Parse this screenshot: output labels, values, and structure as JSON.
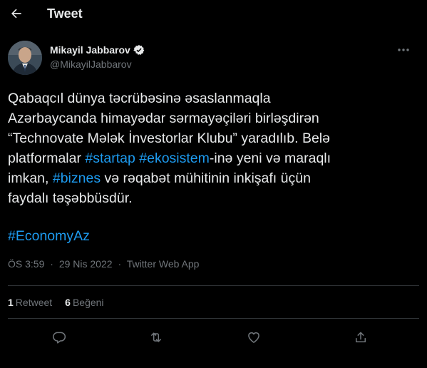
{
  "header": {
    "title": "Tweet",
    "back_icon": "arrow-left-icon"
  },
  "author": {
    "name": "Mikayil Jabbarov",
    "handle": "@MikayilJabbarov",
    "verified_icon": "verified-badge-icon",
    "more_icon": "more-horizontal-icon"
  },
  "tweet": {
    "lines": [
      [
        {
          "text": "Qabaqcıl dünya təcrübəsinə əsaslanmaqla"
        }
      ],
      [
        {
          "text": "Azərbaycanda himayədar sərmayəçiləri birləşdirən"
        }
      ],
      [
        {
          "text": "“Technovate Mələk İnvestorlar Klubu” yaradılıb. Belə"
        }
      ],
      [
        {
          "text": "platformalar "
        },
        {
          "text": "#startap",
          "tag": true
        },
        {
          "text": " "
        },
        {
          "text": "#ekosistem",
          "tag": true
        },
        {
          "text": "-inə yeni və maraqlı"
        }
      ],
      [
        {
          "text": "imkan, "
        },
        {
          "text": "#biznes",
          "tag": true
        },
        {
          "text": " və rəqabət mühitinin inkişafı üçün"
        }
      ],
      [
        {
          "text": "faydalı təşəbbüsdür."
        }
      ]
    ],
    "hashtag_footer": "#EconomyAz"
  },
  "meta": {
    "time": "ÖS 3:59",
    "separator": "·",
    "date": "29 Nis 2022",
    "source": "Twitter Web App"
  },
  "stats": {
    "retweets_count": "1",
    "retweets_label": "Retweet",
    "likes_count": "6",
    "likes_label": "Beğeni"
  },
  "actions": {
    "reply_icon": "reply-icon",
    "retweet_icon": "retweet-icon",
    "like_icon": "heart-icon",
    "share_icon": "share-icon"
  },
  "colors": {
    "background": "#000000",
    "text": "#e7e9ea",
    "secondary": "#71767b",
    "accent": "#1d9bf0",
    "divider": "#2f3336"
  }
}
